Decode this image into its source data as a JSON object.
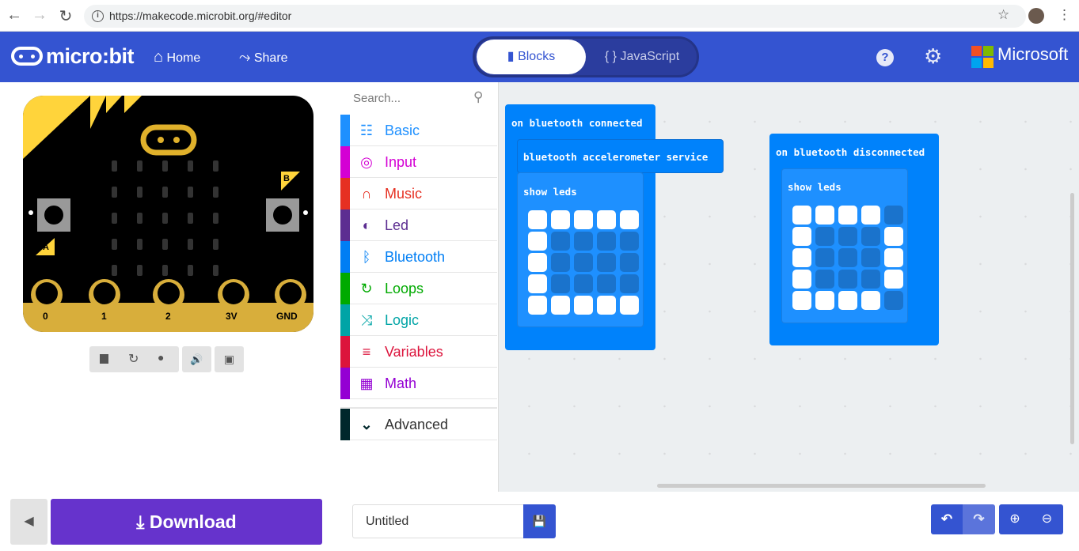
{
  "browser": {
    "url": "https://makecode.microbit.org/#editor"
  },
  "header": {
    "logo": "micro:bit",
    "home": "Home",
    "share": "Share",
    "blocks": "Blocks",
    "javascript": "{ } JavaScript",
    "brand": "Microsoft",
    "ms_colors": [
      "#F25022",
      "#7FBA00",
      "#00A4EF",
      "#FFB900"
    ],
    "color": "#3454D1"
  },
  "simulator": {
    "button_a": "A",
    "button_b": "B",
    "pins": [
      "0",
      "1",
      "2",
      "3V",
      "GND"
    ]
  },
  "toolbox": {
    "search_placeholder": "Search...",
    "items": [
      {
        "label": "Basic",
        "color": "#1E90FF",
        "icon": "grid-icon"
      },
      {
        "label": "Input",
        "color": "#D400D4",
        "icon": "target-icon"
      },
      {
        "label": "Music",
        "color": "#E63022",
        "icon": "headphones-icon"
      },
      {
        "label": "Led",
        "color": "#5C2D91",
        "icon": "toggle-icon"
      },
      {
        "label": "Bluetooth",
        "color": "#007EF4",
        "icon": "bluetooth-icon"
      },
      {
        "label": "Loops",
        "color": "#00AA00",
        "icon": "refresh-icon"
      },
      {
        "label": "Logic",
        "color": "#00A4A6",
        "icon": "shuffle-icon"
      },
      {
        "label": "Variables",
        "color": "#DC143C",
        "icon": "lines-icon"
      },
      {
        "label": "Math",
        "color": "#9400D3",
        "icon": "calculator-icon"
      }
    ],
    "advanced": {
      "label": "Advanced",
      "color": "#00272B"
    }
  },
  "workspace": {
    "block1": {
      "event": "on bluetooth connected",
      "service": "bluetooth accelerometer service",
      "show": "show leds",
      "leds": [
        [
          1,
          1,
          1,
          1,
          1
        ],
        [
          1,
          0,
          0,
          0,
          0
        ],
        [
          1,
          0,
          0,
          0,
          0
        ],
        [
          1,
          0,
          0,
          0,
          0
        ],
        [
          1,
          1,
          1,
          1,
          1
        ]
      ]
    },
    "block2": {
      "event": "on bluetooth disconnected",
      "show": "show leds",
      "leds": [
        [
          1,
          1,
          1,
          1,
          0
        ],
        [
          1,
          0,
          0,
          0,
          1
        ],
        [
          1,
          0,
          0,
          0,
          1
        ],
        [
          1,
          0,
          0,
          0,
          1
        ],
        [
          1,
          1,
          1,
          1,
          0
        ]
      ]
    }
  },
  "bottom": {
    "download": "Download",
    "project_name": "Untitled"
  }
}
